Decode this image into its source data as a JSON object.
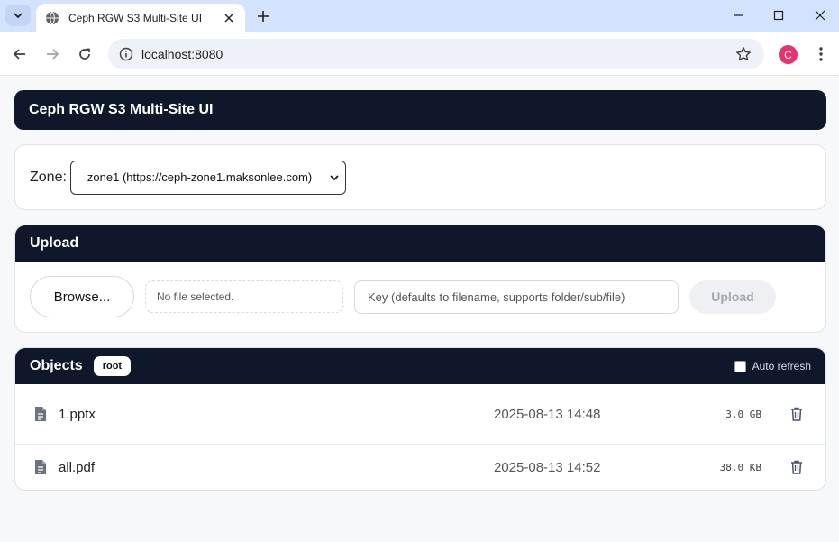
{
  "browser": {
    "tab_title": "Ceph RGW S3 Multi-Site UI",
    "url": "localhost:8080",
    "profile_initial": "C",
    "profile_color": "#e8336f"
  },
  "app": {
    "title": "Ceph RGW S3 Multi-Site UI",
    "accent": "#0f172a"
  },
  "zone": {
    "label": "Zone:",
    "selected": "zone1 (https://ceph-zone1.maksonlee.com)"
  },
  "upload": {
    "heading": "Upload",
    "browse_label": "Browse...",
    "file_status": "No file selected.",
    "key_placeholder": "Key (defaults to filename, supports folder/sub/file)",
    "upload_label": "Upload"
  },
  "objects": {
    "heading": "Objects",
    "path_badge": "root",
    "auto_refresh_label": "Auto refresh",
    "items": [
      {
        "name": "1.pptx",
        "modified": "2025-08-13 14:48",
        "size": "3.0 GB"
      },
      {
        "name": "all.pdf",
        "modified": "2025-08-13 14:52",
        "size": "38.0 KB"
      }
    ]
  }
}
